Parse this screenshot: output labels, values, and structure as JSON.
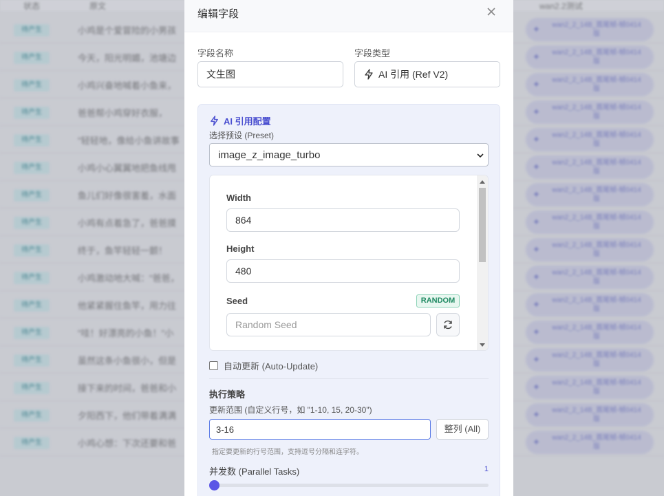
{
  "background": {
    "header": {
      "col1": "状态",
      "col2": "原文",
      "col3": "wan2.2测试"
    },
    "tag_label": "待产生",
    "pill_label": "wan2_2_14B_首尾帧-帧0414版",
    "rows": [
      "小鸡是个爱冒险的小男孩",
      "今天，阳光明媚，池塘边",
      "小鸡兴奋地喊着小鱼来，",
      "爸爸帮小鸡穿好衣服，",
      "\"轻轻地，像给小鱼讲故事",
      "小鸡小心翼翼地把鱼线甩",
      "鱼儿们好像很害羞，水面",
      "小鸡有点着急了，爸爸摸",
      "终于，鱼竿轻轻一颤！",
      "小鸡激动地大喊：\"爸爸，",
      "他紧紧握住鱼竿，用力往",
      "\"哇！好漂亮的小鱼！\"小",
      "虽然这条小鱼很小，但是",
      "接下来的时间，爸爸和小",
      "夕阳西下，他们带着满满",
      "小鸡心想：下次还要和爸"
    ]
  },
  "modal": {
    "title": "编辑字段",
    "field_name_label": "字段名称",
    "field_name_value": "文生图",
    "field_type_label": "字段类型",
    "field_type_value": "AI 引用 (Ref V2)",
    "ai_config_title": "AI 引用配置",
    "preset_label": "选择预设 (Preset)",
    "preset_value": "image_z_image_turbo",
    "params": {
      "width_label": "Width",
      "width_value": "864",
      "height_label": "Height",
      "height_value": "480",
      "seed_label": "Seed",
      "seed_badge": "RANDOM",
      "seed_placeholder": "Random Seed"
    },
    "auto_update_label": "自动更新 (Auto-Update)",
    "strategy_title": "执行策略",
    "range_label": "更新范围 (自定义行号，如 \"1-10, 15, 20-30\")",
    "range_value": "3-16",
    "all_button": "整列 (All)",
    "range_hint": "指定要更新的行号范围，支持逗号分隔和连字符。",
    "parallel_label": "并发数 (Parallel Tasks)",
    "parallel_value": "1"
  },
  "colors": {
    "accent": "#4a4fd0",
    "badge_green": "#1f8a62",
    "slider": "#5b55e6"
  },
  "icons": [
    "close-icon",
    "lightning-icon",
    "chevron-down-icon",
    "refresh-icon"
  ]
}
